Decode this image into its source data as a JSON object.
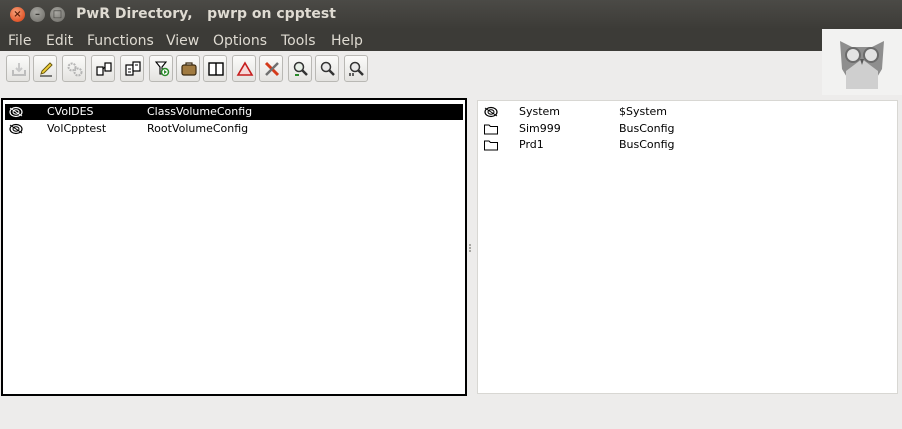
{
  "window": {
    "title": "PwR Directory,   pwrp on cpptest",
    "close_glyph": "×",
    "minimize_glyph": "–",
    "maximize_glyph": "□"
  },
  "menu": [
    "File",
    "Edit",
    "Functions",
    "View",
    "Options",
    "Tools",
    "Help"
  ],
  "toolbar": {
    "buttons": [
      {
        "icon": "save-icon"
      },
      {
        "icon": "edit-pencil-icon"
      },
      {
        "icon": "build-gears-icon"
      },
      {
        "icon": "distribute-icon"
      },
      {
        "icon": "plc-icon"
      },
      {
        "icon": "open-file-icon"
      },
      {
        "icon": "package-icon"
      },
      {
        "icon": "book-icon"
      },
      {
        "icon": "alarm-triangle-icon"
      },
      {
        "icon": "tools-icon"
      },
      {
        "icon": "zoom-in-icon"
      },
      {
        "icon": "zoom-reset-icon"
      },
      {
        "icon": "zoom-out-icon"
      }
    ]
  },
  "logo": {
    "icon": "owl-logo-icon"
  },
  "left_pane": {
    "rows": [
      {
        "name": "CVolDES",
        "class": "ClassVolumeConfig",
        "icon": "volume-icon",
        "selected": true
      },
      {
        "name": "VolCpptest",
        "class": "RootVolumeConfig",
        "icon": "volume-icon",
        "selected": false
      }
    ]
  },
  "right_pane": {
    "rows": [
      {
        "name": "System",
        "class": "$System",
        "icon": "volume-icon"
      },
      {
        "name": "Sim999",
        "class": "BusConfig",
        "icon": "folder-icon"
      },
      {
        "name": "Prd1",
        "class": "BusConfig",
        "icon": "folder-icon"
      }
    ]
  }
}
